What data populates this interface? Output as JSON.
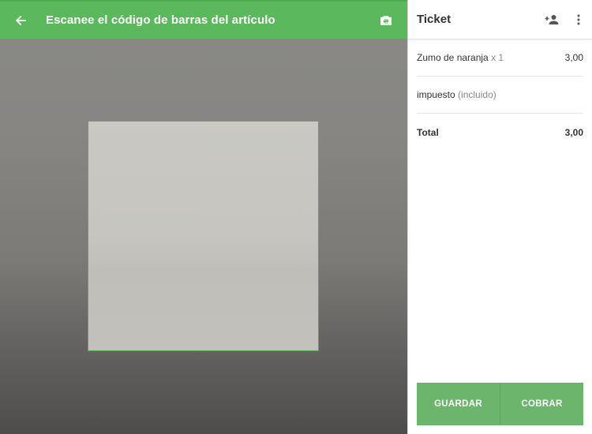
{
  "scanner": {
    "title": "Escanee el código de barras del artículo",
    "back_icon": "arrow-left-icon",
    "camera_icon": "camera-switch-icon"
  },
  "ticket": {
    "title": "Ticket",
    "add_customer_icon": "add-person-icon",
    "menu_icon": "more-vert-icon",
    "items": [
      {
        "name": "Zumo de naranja",
        "qty": "x 1",
        "price": "3,00"
      }
    ],
    "tax_label": "impuesto",
    "tax_note": "(incluido)",
    "total_label": "Total",
    "total_value": "3,00",
    "save_label": "GUARDAR",
    "charge_label": "COBRAR"
  },
  "colors": {
    "accent": "#5cb85c",
    "button": "#6cb56c",
    "frame": "#5aa85a"
  }
}
